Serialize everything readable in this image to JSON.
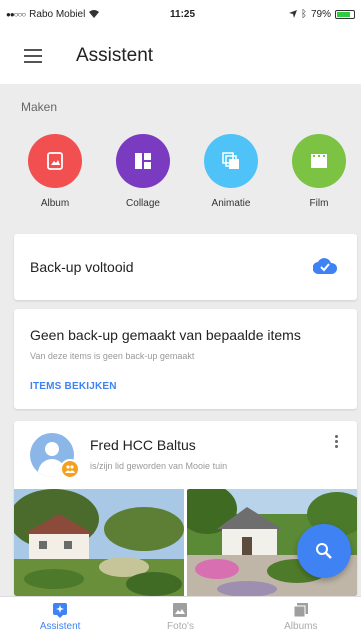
{
  "status_bar": {
    "carrier": "Rabo Mobiel",
    "time": "11:25",
    "battery": "79%",
    "battery_level": 0.79
  },
  "header": {
    "title": "Assistent"
  },
  "make_section": {
    "label": "Maken",
    "items": [
      {
        "label": "Album",
        "color": "#f25050",
        "icon": "album-icon"
      },
      {
        "label": "Collage",
        "color": "#7a3bc1",
        "icon": "collage-icon"
      },
      {
        "label": "Animatie",
        "color": "#4fc3f7",
        "icon": "animation-icon"
      },
      {
        "label": "Film",
        "color": "#7cc243",
        "icon": "film-icon"
      }
    ]
  },
  "backup_card": {
    "text": "Back-up voltooid",
    "icon": "cloud-done-icon"
  },
  "no_backup_card": {
    "title": "Geen back-up gemaakt van bepaalde items",
    "subtitle": "Van deze items is geen back-up gemaakt",
    "link": "ITEMS BEKIJKEN"
  },
  "share_card": {
    "name": "Fred HCC Baltus",
    "description": "is/zijn lid geworden van Mooie tuin"
  },
  "bottom_nav": {
    "tabs": [
      {
        "label": "Assistent",
        "icon": "assistant-icon",
        "active": true
      },
      {
        "label": "Foto's",
        "icon": "photos-icon",
        "active": false
      },
      {
        "label": "Albums",
        "icon": "albums-icon",
        "active": false
      }
    ]
  },
  "colors": {
    "accent": "#3f82f4"
  }
}
